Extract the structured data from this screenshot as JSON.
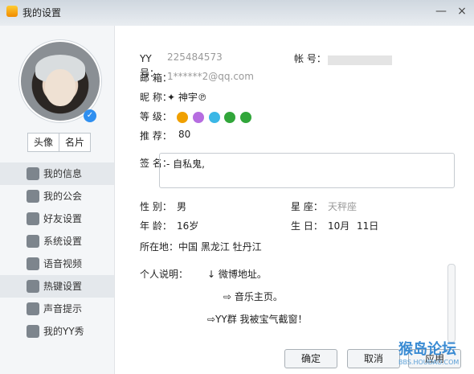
{
  "window": {
    "title": "我的设置",
    "close_glyph": "×",
    "min_glyph": "—"
  },
  "sidebar": {
    "tabs": [
      "头像",
      "名片"
    ],
    "items": [
      {
        "label": "我的信息",
        "icon": "id-card-icon",
        "active": true
      },
      {
        "label": "我的公会",
        "icon": "flag-icon",
        "active": false
      },
      {
        "label": "好友设置",
        "icon": "friends-icon",
        "active": false
      },
      {
        "label": "系统设置",
        "icon": "gear-icon",
        "active": false
      },
      {
        "label": "语音视频",
        "icon": "mic-icon",
        "active": false
      },
      {
        "label": "热键设置",
        "icon": "keyboard-icon",
        "active": true
      },
      {
        "label": "声音提示",
        "icon": "music-note-icon",
        "active": false
      },
      {
        "label": "我的YY秀",
        "icon": "shirt-icon",
        "active": false
      }
    ]
  },
  "profile": {
    "yy_label": "YY 号：",
    "yy_value": "225484573",
    "account_label": "帐 号：",
    "email_label": "邮 箱：",
    "email_value": "1******2@qq.com",
    "nick_label": "昵 称：",
    "nick_value": "✦ 神宇℗",
    "level_label": "等 级：",
    "recommend_label": "推 荐：",
    "recommend_value": "80",
    "sign_label": "签 名：",
    "sign_value": "- 自私鬼,",
    "gender_label": "性 别：",
    "gender_value": "男",
    "star_label": "星 座：",
    "star_value": "天秤座",
    "age_label": "年 龄：",
    "age_value": "16岁",
    "birth_label": "生 日：",
    "birth_month": "10月",
    "birth_day": "11日",
    "location_label": "所在地：",
    "location_value": "中国 黑龙江 牡丹江",
    "desc_label": "个人说明：",
    "desc_lines": [
      "↓        微博地址。",
      "⇨          音乐主页。",
      "⇨YY群          我被宝气截窗！"
    ]
  },
  "buttons": {
    "ok": "确定",
    "cancel": "取消",
    "apply": "应用"
  },
  "watermark": {
    "title": "猴岛论坛",
    "sub": "BBS.HOUDAO.COM"
  }
}
